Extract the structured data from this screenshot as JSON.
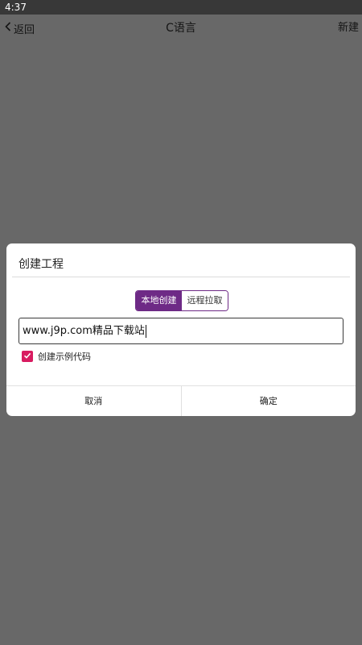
{
  "status_bar": {
    "time": "4:37"
  },
  "toolbar": {
    "back_label": "返回",
    "title": "C语言",
    "new_label": "新建"
  },
  "dialog": {
    "title": "创建工程",
    "tabs": [
      {
        "label": "本地创建",
        "selected": true
      },
      {
        "label": "远程拉取",
        "selected": false
      }
    ],
    "project_name_value": "www.j9p.com精品下载站",
    "create_sample_label": "创建示例代码",
    "create_sample_checked": true,
    "cancel_label": "取消",
    "confirm_label": "确定"
  },
  "colors": {
    "accent": "#6e2a86",
    "checkbox": "#d81b60",
    "overlay": "#686868",
    "status_bar": "#383838"
  },
  "icons": {
    "back": "chevron-left-icon",
    "check": "check-icon"
  }
}
